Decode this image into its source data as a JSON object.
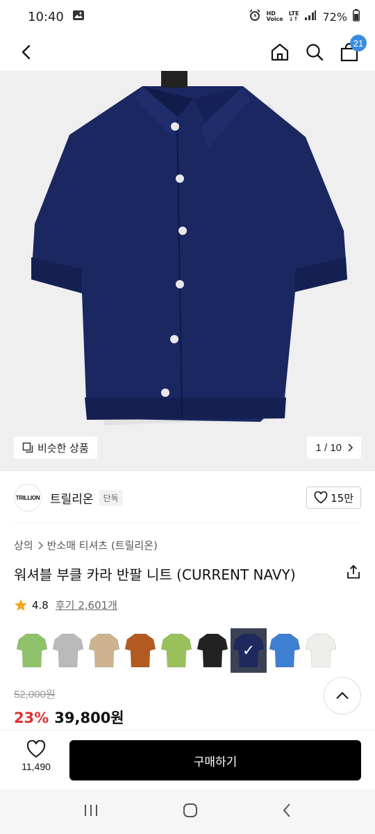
{
  "status_bar": {
    "time": "10:40",
    "hd_top": "HD",
    "hd_bottom": "Voice",
    "lte_top": "LTE",
    "battery": "72%"
  },
  "nav": {
    "cart_count": "21"
  },
  "hero": {
    "similar_label": "비슷한 상품",
    "pager": "1 / 10",
    "product_color": "#1a2761"
  },
  "brand": {
    "logo_text": "TRILLION",
    "name": "트릴리온",
    "badge": "단독",
    "likes": "15만"
  },
  "breadcrumb": {
    "category": "상의",
    "subcategory": "반소매 티셔츠 (트릴리온)"
  },
  "product": {
    "title": "워셔블 부클 카라 반팔 니트 (CURRENT NAVY)",
    "rating": "4.8",
    "reviews": "후기 2,601개"
  },
  "swatches": [
    {
      "name": "lime",
      "color": "#8fc26b",
      "selected": false
    },
    {
      "name": "gray",
      "color": "#b9b9b9",
      "selected": false
    },
    {
      "name": "beige",
      "color": "#cdb38f",
      "selected": false
    },
    {
      "name": "brown",
      "color": "#b35a23",
      "selected": false
    },
    {
      "name": "green",
      "color": "#99c05a",
      "selected": false
    },
    {
      "name": "black",
      "color": "#222222",
      "selected": false
    },
    {
      "name": "navy",
      "color": "#1e2a5e",
      "selected": true
    },
    {
      "name": "blue",
      "color": "#3f7fd1",
      "selected": false
    },
    {
      "name": "white",
      "color": "#eeeeea",
      "selected": false
    }
  ],
  "price": {
    "original": "52,000원",
    "discount": "23%",
    "final": "39,800원"
  },
  "action_bar": {
    "wish_count": "11,490",
    "buy_label": "구매하기"
  },
  "colors": {
    "accent_badge": "#3a8dde",
    "discount": "#e0312d",
    "buy_button": "#000000"
  }
}
